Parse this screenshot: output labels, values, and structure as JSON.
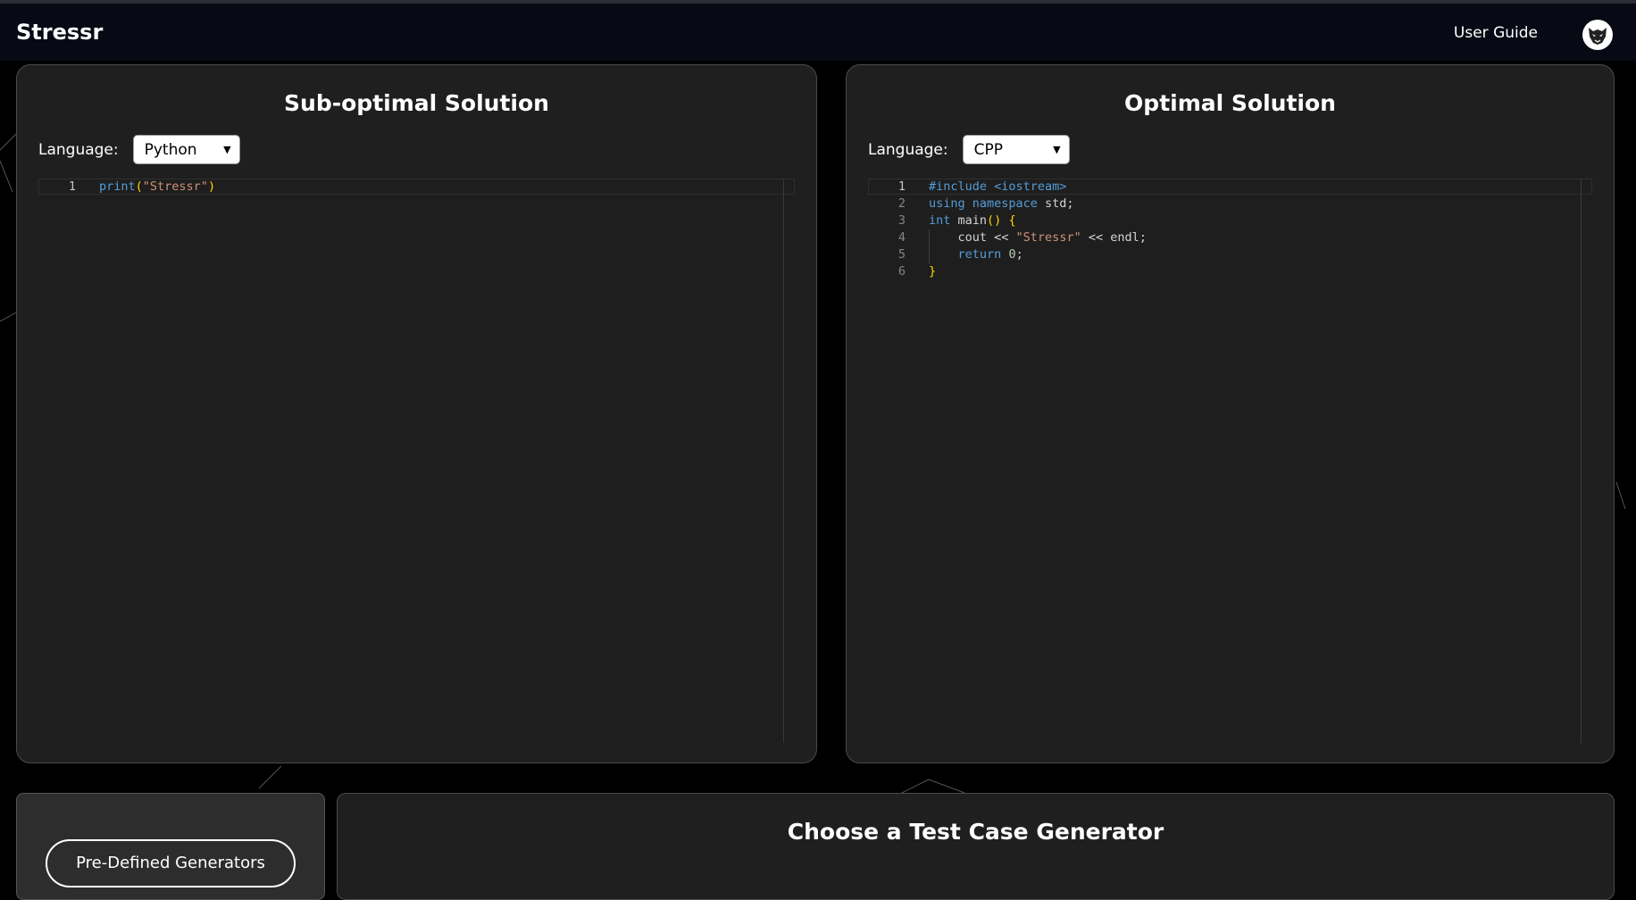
{
  "app": {
    "brand": "Stressr",
    "user_guide_label": "User Guide"
  },
  "left_panel": {
    "title": "Sub-optimal Solution",
    "language_label": "Language:",
    "language_value": "Python",
    "line_numbers": [
      "1"
    ],
    "code": [
      "print(\"Stressr\")"
    ]
  },
  "right_panel": {
    "title": "Optimal Solution",
    "language_label": "Language:",
    "language_value": "CPP",
    "line_numbers": [
      "1",
      "2",
      "3",
      "4",
      "5",
      "6"
    ],
    "code": [
      "#include <iostream>",
      "using namespace std;",
      "int main() {",
      "    cout << \"Stressr\" << endl;",
      "    return 0;",
      "}"
    ]
  },
  "generators": {
    "predefined_button": "Pre-Defined Generators",
    "title": "Choose a Test Case Generator"
  },
  "icons": {
    "avatar": "wolf-avatar-icon",
    "dropdown": "chevron-down-icon"
  }
}
